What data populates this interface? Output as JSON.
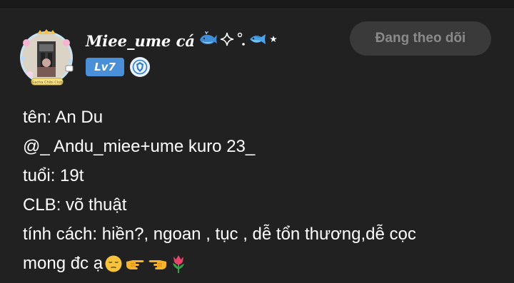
{
  "profile": {
    "username": "Miee_ume cá",
    "level_label": "Lv7",
    "follow_button_label": "Đang theo dõi",
    "avatar_caption": "Gacha Chibi Club"
  },
  "bio": {
    "lines": [
      "tên: An Du",
      "@_ Andu_miee+ume kuro 23_",
      "tuổi: 19t",
      "CLB: võ thuật",
      "tính cách: hiền?, ngoan , tục , dễ tổn thương,dễ cọc",
      "mong đc ạ"
    ]
  },
  "colors": {
    "background": "#212121",
    "level_badge": "#4a90d9",
    "follow_button_bg": "#3a3a3a",
    "follow_button_text": "#8a8a8a",
    "text": "#ffffff"
  },
  "icons": {
    "username_decorations": [
      "whale-icon",
      "sparkle-icon",
      "degree-icon",
      "fish-icon",
      "star-icon"
    ],
    "bio_emoji": [
      "pensive-face-icon",
      "pointing-right-icon",
      "pointing-left-icon",
      "tulip-icon"
    ],
    "verified_badge": "shield-icon"
  }
}
